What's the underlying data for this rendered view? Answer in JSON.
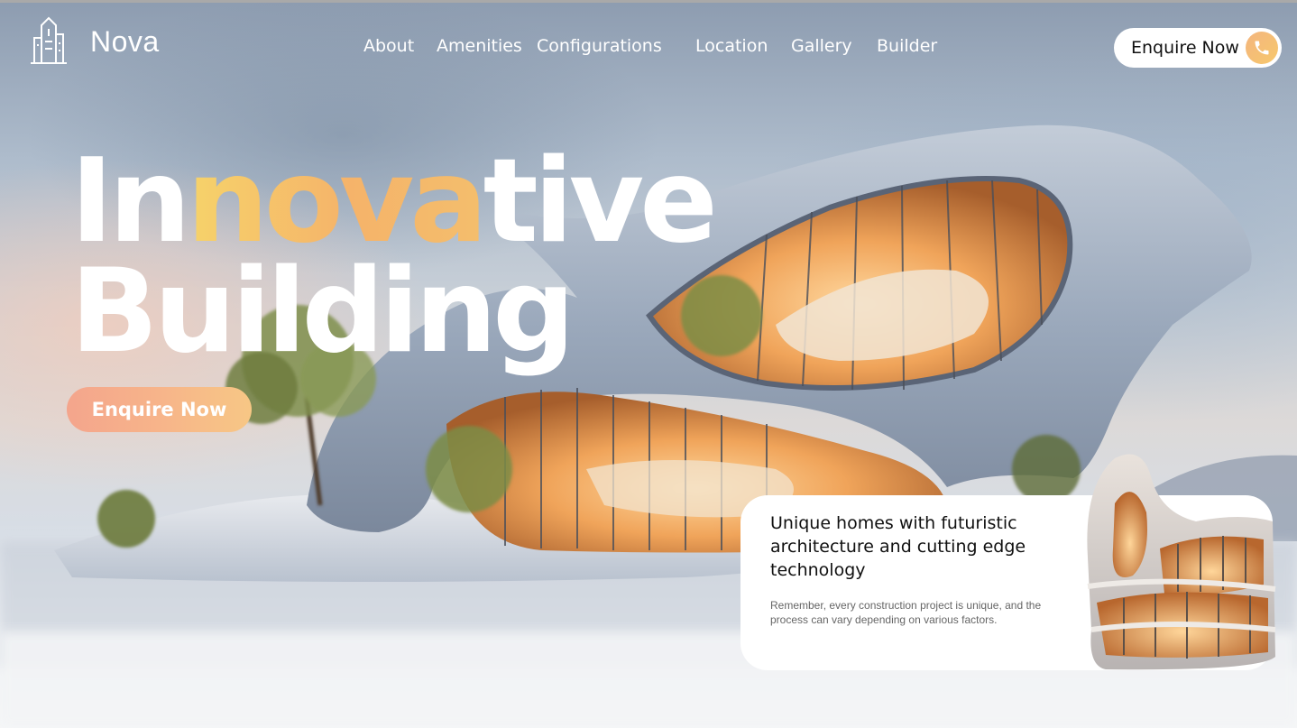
{
  "brand": {
    "name": "Nova",
    "logo_icon": "building-icon"
  },
  "nav": {
    "items": [
      {
        "label": "About"
      },
      {
        "label": "Amenities"
      },
      {
        "label": "Configurations"
      },
      {
        "label": "Location"
      },
      {
        "label": "Gallery"
      },
      {
        "label": "Builder"
      }
    ]
  },
  "header_cta": {
    "label": "Enquire Now",
    "icon": "phone-icon"
  },
  "hero": {
    "title_line1": {
      "part1": "In",
      "part2": "nova",
      "part3": "tive"
    },
    "title_line2": "Building",
    "cta_label": "Enquire Now"
  },
  "card": {
    "title": "Unique homes with futuristic architecture and cutting edge technology",
    "text": "Remember, every construction project is unique, and the process can vary depending on various factors."
  },
  "colors": {
    "accent_gradient_start": "#f4a58c",
    "accent_gradient_end": "#f7c785",
    "heading_gradient": "#f5b36a",
    "text_dark": "#111111"
  }
}
